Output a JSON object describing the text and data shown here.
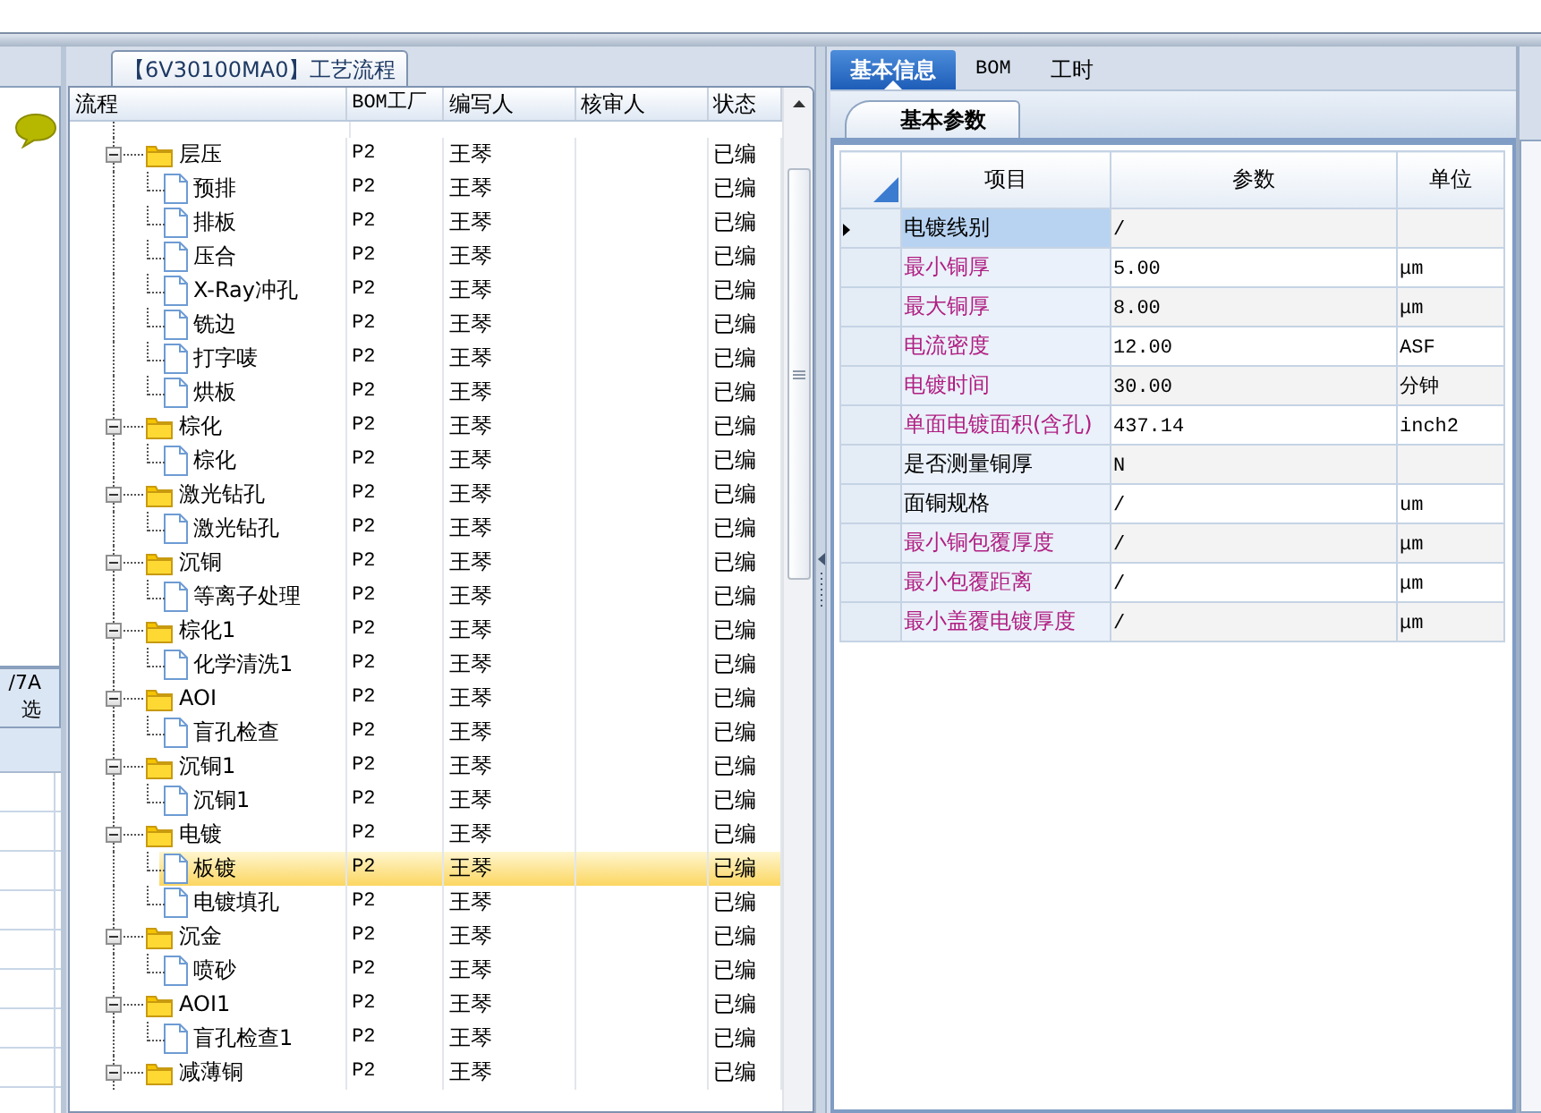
{
  "left_panel": {
    "texts": [
      "/7A",
      "选"
    ]
  },
  "process_panel": {
    "title": "【6V30100MA0】工艺流程",
    "columns": [
      "流程",
      "BOM工厂",
      "编写人",
      "核审人",
      "状态"
    ],
    "tree": [
      {
        "name": "层压",
        "factory": "P2",
        "writer": "王琴",
        "status": "已编",
        "expanded": true,
        "selected": false,
        "children": [
          {
            "name": "预排",
            "factory": "P2",
            "writer": "王琴",
            "status": "已编",
            "selected": false
          },
          {
            "name": "排板",
            "factory": "P2",
            "writer": "王琴",
            "status": "已编",
            "selected": false
          },
          {
            "name": "压合",
            "factory": "P2",
            "writer": "王琴",
            "status": "已编",
            "selected": false
          },
          {
            "name": "X-Ray冲孔",
            "factory": "P2",
            "writer": "王琴",
            "status": "已编",
            "selected": false
          },
          {
            "name": "铣边",
            "factory": "P2",
            "writer": "王琴",
            "status": "已编",
            "selected": false
          },
          {
            "name": "打字唛",
            "factory": "P2",
            "writer": "王琴",
            "status": "已编",
            "selected": false
          },
          {
            "name": "烘板",
            "factory": "P2",
            "writer": "王琴",
            "status": "已编",
            "selected": false
          }
        ]
      },
      {
        "name": "棕化",
        "factory": "P2",
        "writer": "王琴",
        "status": "已编",
        "expanded": true,
        "selected": false,
        "children": [
          {
            "name": "棕化",
            "factory": "P2",
            "writer": "王琴",
            "status": "已编",
            "selected": false
          }
        ]
      },
      {
        "name": "激光钻孔",
        "factory": "P2",
        "writer": "王琴",
        "status": "已编",
        "expanded": true,
        "selected": false,
        "children": [
          {
            "name": "激光钻孔",
            "factory": "P2",
            "writer": "王琴",
            "status": "已编",
            "selected": false
          }
        ]
      },
      {
        "name": "沉铜",
        "factory": "P2",
        "writer": "王琴",
        "status": "已编",
        "expanded": true,
        "selected": false,
        "children": [
          {
            "name": "等离子处理",
            "factory": "P2",
            "writer": "王琴",
            "status": "已编",
            "selected": false
          }
        ]
      },
      {
        "name": "棕化1",
        "factory": "P2",
        "writer": "王琴",
        "status": "已编",
        "expanded": true,
        "selected": false,
        "children": [
          {
            "name": "化学清洗1",
            "factory": "P2",
            "writer": "王琴",
            "status": "已编",
            "selected": false
          }
        ]
      },
      {
        "name": "AOI",
        "factory": "P2",
        "writer": "王琴",
        "status": "已编",
        "expanded": true,
        "selected": false,
        "children": [
          {
            "name": "盲孔检查",
            "factory": "P2",
            "writer": "王琴",
            "status": "已编",
            "selected": false
          }
        ]
      },
      {
        "name": "沉铜1",
        "factory": "P2",
        "writer": "王琴",
        "status": "已编",
        "expanded": true,
        "selected": false,
        "children": [
          {
            "name": "沉铜1",
            "factory": "P2",
            "writer": "王琴",
            "status": "已编",
            "selected": false
          }
        ]
      },
      {
        "name": "电镀",
        "factory": "P2",
        "writer": "王琴",
        "status": "已编",
        "expanded": true,
        "selected": false,
        "children": [
          {
            "name": "板镀",
            "factory": "P2",
            "writer": "王琴",
            "status": "已编",
            "selected": true
          },
          {
            "name": "电镀填孔",
            "factory": "P2",
            "writer": "王琴",
            "status": "已编",
            "selected": false
          }
        ]
      },
      {
        "name": "沉金",
        "factory": "P2",
        "writer": "王琴",
        "status": "已编",
        "expanded": true,
        "selected": false,
        "children": [
          {
            "name": "喷砂",
            "factory": "P2",
            "writer": "王琴",
            "status": "已编",
            "selected": false
          }
        ]
      },
      {
        "name": "AOI1",
        "factory": "P2",
        "writer": "王琴",
        "status": "已编",
        "expanded": true,
        "selected": false,
        "children": [
          {
            "name": "盲孔检查1",
            "factory": "P2",
            "writer": "王琴",
            "status": "已编",
            "selected": false
          }
        ]
      },
      {
        "name": "减薄铜",
        "factory": "P2",
        "writer": "王琴",
        "status": "已编",
        "expanded": true,
        "selected": false
      }
    ]
  },
  "detail_panel": {
    "tabs": [
      {
        "label": "基本信息",
        "selected": true
      },
      {
        "label": "BOM",
        "selected": false
      },
      {
        "label": "工时",
        "selected": false
      }
    ],
    "subtab": "基本参数",
    "columns": [
      "项目",
      "参数",
      "单位"
    ],
    "rows": [
      {
        "item": "电镀线别",
        "value": "/",
        "required": false,
        "selected": true
      },
      {
        "item": "最小铜厚",
        "value": "5.00",
        "unit": "μm",
        "required": true,
        "selected": false
      },
      {
        "item": "最大铜厚",
        "value": "8.00",
        "unit": "μm",
        "required": true,
        "selected": false
      },
      {
        "item": "电流密度",
        "value": "12.00",
        "unit": "ASF",
        "required": true,
        "selected": false
      },
      {
        "item": "电镀时间",
        "value": "30.00",
        "unit": "分钟",
        "required": true,
        "selected": false
      },
      {
        "item": "单面电镀面积(含孔)",
        "value": "437.14",
        "unit": "inch2",
        "required": true,
        "selected": false
      },
      {
        "item": "是否测量铜厚",
        "value": "N",
        "required": false,
        "selected": false
      },
      {
        "item": "面铜规格",
        "value": "/",
        "unit": "um",
        "required": false,
        "selected": false
      },
      {
        "item": "最小铜包覆厚度",
        "value": "/",
        "unit": "μm",
        "required": true,
        "selected": false
      },
      {
        "item": "最小包覆距离",
        "value": "/",
        "unit": "μm",
        "required": true,
        "selected": false
      },
      {
        "item": "最小盖覆电镀厚度",
        "value": "/",
        "unit": "μm",
        "required": true,
        "selected": false
      }
    ]
  },
  "next_panel": {
    "kind": "panel"
  }
}
